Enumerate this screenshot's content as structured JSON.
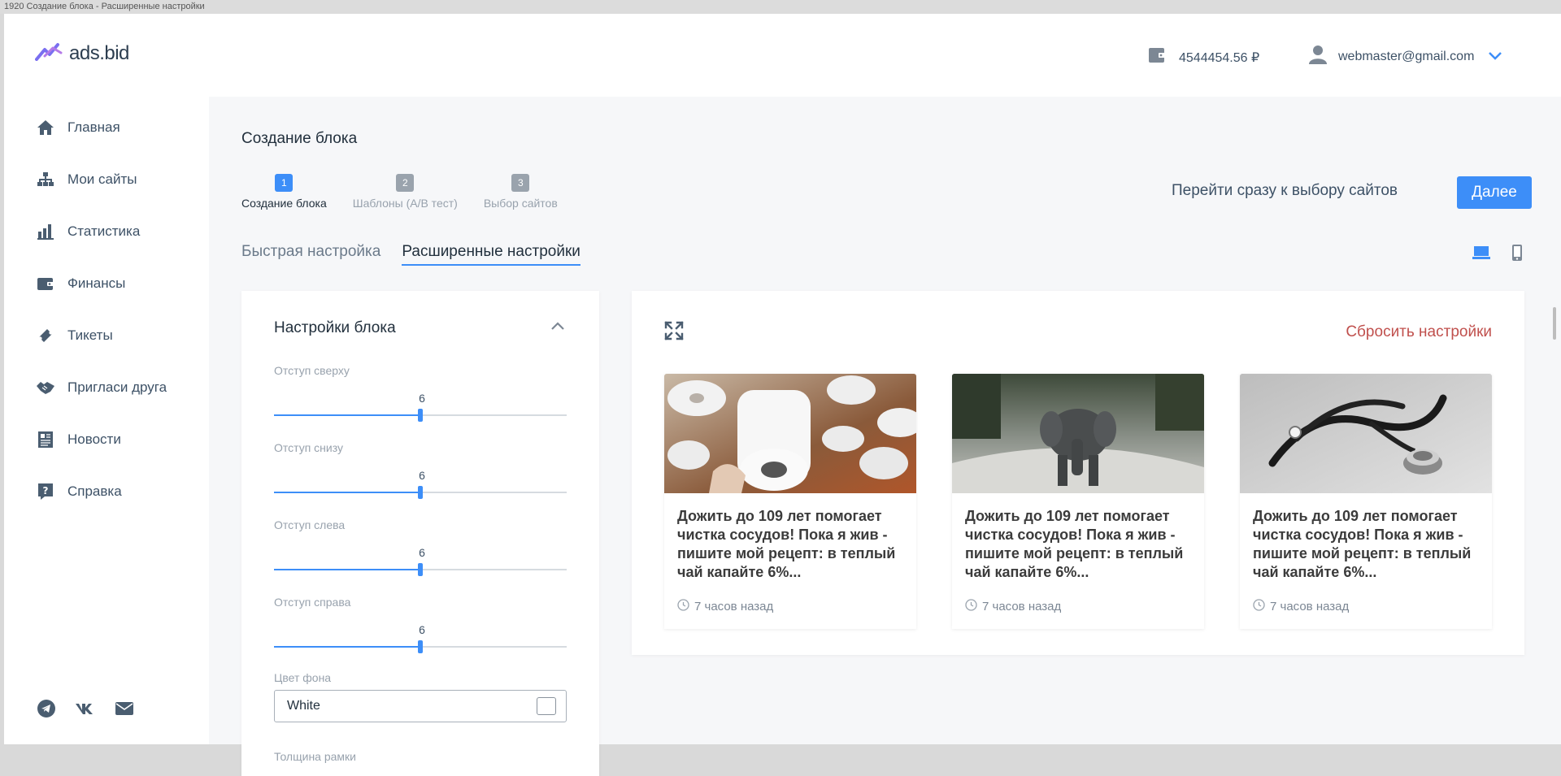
{
  "window": {
    "title": "1920 Создание блока - Расширенные настройки"
  },
  "logo": {
    "text": "ads.bid"
  },
  "sidebar": {
    "items": [
      {
        "label": "Главная",
        "icon": "home-icon"
      },
      {
        "label": "Мои сайты",
        "icon": "sitemap-icon"
      },
      {
        "label": "Статистика",
        "icon": "bar-chart-icon"
      },
      {
        "label": "Финансы",
        "icon": "wallet-icon"
      },
      {
        "label": "Тикеты",
        "icon": "ticket-icon"
      },
      {
        "label": "Пригласи друга",
        "icon": "handshake-icon"
      },
      {
        "label": "Новости",
        "icon": "newspaper-icon"
      },
      {
        "label": "Справка",
        "icon": "help-icon"
      }
    ],
    "social": [
      "telegram-icon",
      "vk-icon",
      "mail-icon"
    ]
  },
  "header": {
    "balance": "4544454.56 ₽",
    "email": "webmaster@gmail.com"
  },
  "page": {
    "title": "Создание блока",
    "steps": [
      {
        "num": "1",
        "label": "Создание блока"
      },
      {
        "num": "2",
        "label": "Шаблоны (А/В тест)"
      },
      {
        "num": "3",
        "label": "Выбор сайтов"
      }
    ],
    "skip_link": "Перейти сразу к выбору сайтов",
    "next_button": "Далее",
    "tabs": [
      "Быстрая настройка",
      "Расширенные настройки"
    ]
  },
  "settings": {
    "title": "Настройки блока",
    "sliders": [
      {
        "label": "Отступ сверху",
        "value": "6",
        "fraction": 0.5
      },
      {
        "label": "Отступ снизу",
        "value": "6",
        "fraction": 0.5
      },
      {
        "label": "Отступ слева",
        "value": "6",
        "fraction": 0.5
      },
      {
        "label": "Отступ справа",
        "value": "6",
        "fraction": 0.5
      }
    ],
    "bg_color_label": "Цвет фона",
    "bg_color_value": "White",
    "border_label": "Толщина рамки"
  },
  "preview": {
    "reset": "Сбросить настройки",
    "cards": [
      {
        "text": "Дожить до 109 лет помогает чистка сосудов! Пока я жив - пишите мой рецепт: в теплый чай капайте 6%...",
        "time": "7 часов назад",
        "image": "toilet-paper"
      },
      {
        "text": "Дожить до 109 лет помогает чистка сосудов! Пока я жив - пишите мой рецепт: в теплый чай капайте 6%...",
        "time": "7 часов назад",
        "image": "elephant"
      },
      {
        "text": "Дожить до 109 лет помогает чистка сосудов! Пока я жив - пишите мой рецепт: в теплый чай капайте 6%...",
        "time": "7 часов назад",
        "image": "stethoscope"
      }
    ]
  },
  "colors": {
    "accent": "#3d8ef8",
    "reset": "#c0504d",
    "text": "#22303d"
  }
}
